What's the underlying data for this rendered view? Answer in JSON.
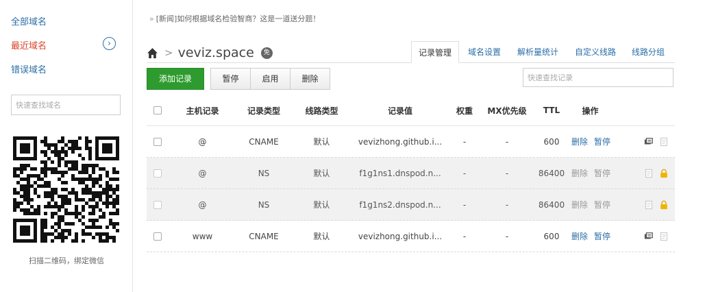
{
  "sidebar": {
    "items": [
      {
        "label": "全部域名"
      },
      {
        "label": "最近域名"
      },
      {
        "label": "错误域名"
      }
    ],
    "expand_glyph": "›",
    "search_placeholder": "快速查找域名",
    "qr_caption": "扫描二维码，绑定微信"
  },
  "news": {
    "arrow": "»",
    "text": "[新闻]如何根据域名检验智商？这是一道送分题！"
  },
  "domain": {
    "name": "veviz.space",
    "badge": "免",
    "separator": ">"
  },
  "tabs": [
    {
      "label": "记录管理",
      "active": true
    },
    {
      "label": "域名设置"
    },
    {
      "label": "解析量统计"
    },
    {
      "label": "自定义线路"
    },
    {
      "label": "线路分组"
    }
  ],
  "toolbar": {
    "add_label": "添加记录",
    "pause_label": "暂停",
    "enable_label": "启用",
    "delete_label": "删除",
    "search_placeholder": "快速查找记录"
  },
  "table": {
    "headers": {
      "host": "主机记录",
      "type": "记录类型",
      "line": "线路类型",
      "value": "记录值",
      "weight": "权重",
      "mx": "MX优先级",
      "ttl": "TTL",
      "ops": "操作"
    },
    "rows": [
      {
        "host": "@",
        "type": "CNAME",
        "line": "默认",
        "value": "vevizhong.github.i...",
        "weight": "-",
        "mx": "-",
        "ttl": "600",
        "op_delete": "删除",
        "op_pause": "暂停",
        "locked": false
      },
      {
        "host": "@",
        "type": "NS",
        "line": "默认",
        "value": "f1g1ns1.dnspod.n...",
        "weight": "-",
        "mx": "-",
        "ttl": "86400",
        "op_delete": "删除",
        "op_pause": "暂停",
        "locked": true
      },
      {
        "host": "@",
        "type": "NS",
        "line": "默认",
        "value": "f1g1ns2.dnspod.n...",
        "weight": "-",
        "mx": "-",
        "ttl": "86400",
        "op_delete": "删除",
        "op_pause": "暂停",
        "locked": true
      },
      {
        "host": "www",
        "type": "CNAME",
        "line": "默认",
        "value": "vevizhong.github.i...",
        "weight": "-",
        "mx": "-",
        "ttl": "600",
        "op_delete": "删除",
        "op_pause": "暂停",
        "locked": false
      }
    ]
  },
  "colors": {
    "accent": "#2a6ea8",
    "active_nav": "#d9432b",
    "add_button": "#2e9b2e",
    "lock": "#f0b400"
  }
}
